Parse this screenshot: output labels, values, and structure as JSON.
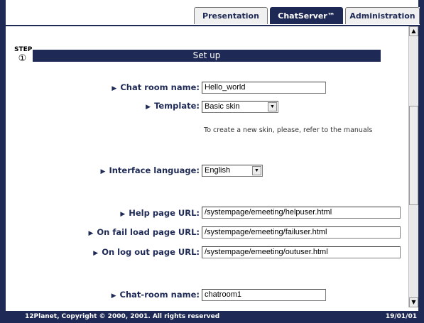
{
  "tabs": [
    {
      "label": "Presentation"
    },
    {
      "label": "ChatServer™"
    },
    {
      "label": "Administration"
    }
  ],
  "step": {
    "label": "STEP",
    "number": "①"
  },
  "section_title": "Set up",
  "fields": {
    "chat_room_name": {
      "label": "Chat room name:",
      "value": "Hello_world"
    },
    "template": {
      "label": "Template:",
      "value": "Basic skin"
    },
    "template_note": "To create a new skin, please, refer to the manuals",
    "interface_language": {
      "label": "Interface language:",
      "value": "English"
    },
    "help_page_url": {
      "label": "Help page URL:",
      "value": "/systempage/emeeting/helpuser.html"
    },
    "fail_load_url": {
      "label": "On fail load page URL:",
      "value": "/systempage/emeeting/failuser.html"
    },
    "log_out_url": {
      "label": "On log out page URL:",
      "value": "/systempage/emeeting/outuser.html"
    },
    "chat_room_name_2": {
      "label": "Chat-room name:",
      "value": "chatroom1"
    }
  },
  "footer": {
    "copyright": "12Planet, Copyright © 2000, 2001. All rights reserved",
    "date": "19/01/01"
  },
  "colors": {
    "navy": "#1e2a55",
    "white": "#ffffff"
  },
  "icons": {
    "bullet": "triangle-right-icon",
    "scroll_up": "arrow-up-icon",
    "scroll_down": "arrow-down-icon",
    "dropdown": "chevron-down-icon"
  }
}
